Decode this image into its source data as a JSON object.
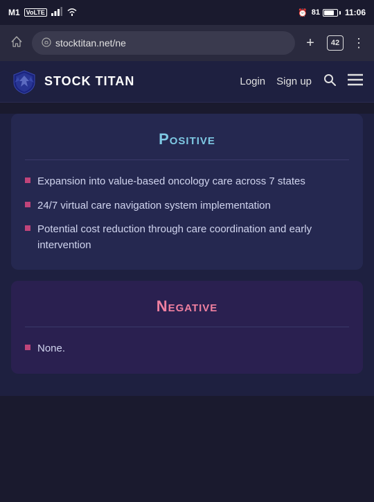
{
  "statusBar": {
    "carrier": "M1",
    "volte": "VoLTE",
    "signal": "▲▲▲",
    "wifi": "WiFi",
    "alarm": "⏰",
    "battery_pct": "81",
    "time": "11:06"
  },
  "browserBar": {
    "url": "stocktitan.net/ne",
    "tabs_count": "42",
    "home_icon": "⌂",
    "add_tab_icon": "+",
    "menu_icon": "⋮"
  },
  "navbar": {
    "logo_text": "STOCK TITAN",
    "login_label": "Login",
    "signup_label": "Sign up"
  },
  "positive_section": {
    "title": "Positive",
    "bullets": [
      "Expansion into value-based oncology care across 7 states",
      "24/7 virtual care navigation system implementation",
      "Potential cost reduction through care coordination and early intervention"
    ]
  },
  "negative_section": {
    "title": "Negative",
    "bullets": [
      "None."
    ]
  }
}
